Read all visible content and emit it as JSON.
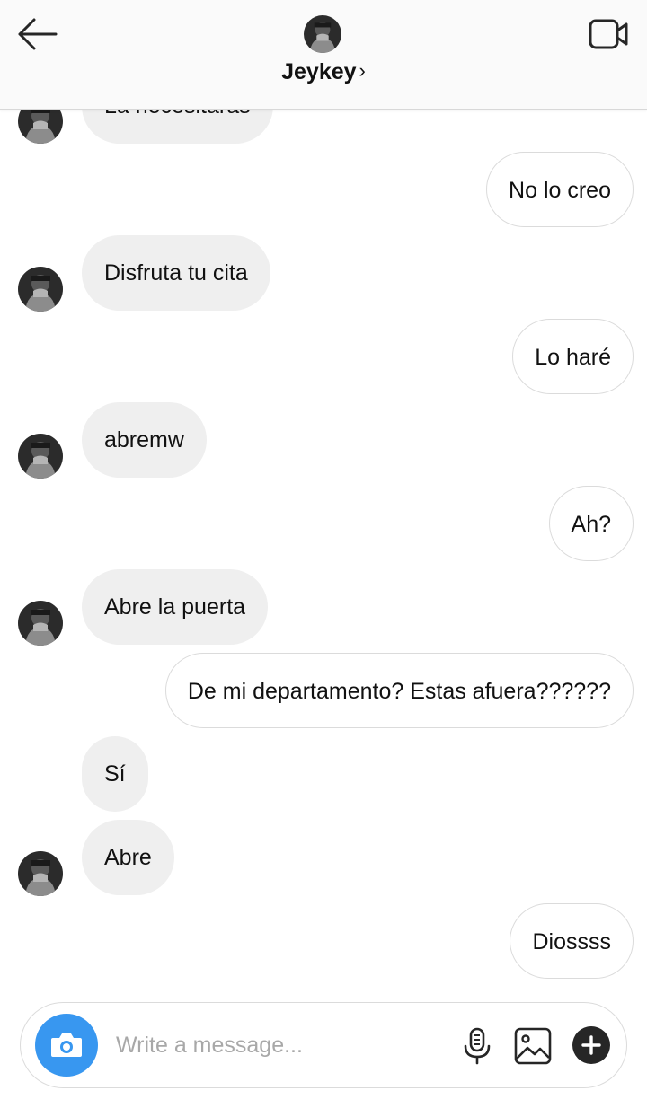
{
  "header": {
    "contact_name": "Jeykey",
    "chevron": "›",
    "back_icon": "arrow-left-icon",
    "video_icon": "video-camera-icon"
  },
  "messages": [
    {
      "from": "them",
      "text": "La necesitarás",
      "avatar": true
    },
    {
      "from": "me",
      "text": "No lo creo"
    },
    {
      "from": "them",
      "text": "Disfruta tu cita",
      "avatar": true
    },
    {
      "from": "me",
      "text": "Lo haré"
    },
    {
      "from": "them",
      "text": "abremw",
      "avatar": true
    },
    {
      "from": "me",
      "text": "Ah?"
    },
    {
      "from": "them",
      "text": "Abre la puerta",
      "avatar": true
    },
    {
      "from": "me",
      "text": "De mi departamento? Estas afuera??????"
    },
    {
      "from": "them",
      "text": "Sí",
      "avatar": false
    },
    {
      "from": "them",
      "text": "Abre",
      "avatar": true
    },
    {
      "from": "me",
      "text": "Diossss"
    }
  ],
  "composer": {
    "placeholder": "Write a message...",
    "value": "",
    "icons": [
      "camera-icon",
      "microphone-icon",
      "gallery-icon",
      "plus-icon"
    ]
  },
  "colors": {
    "accent": "#3897f0",
    "incoming_bubble": "#efefef",
    "outgoing_border": "#dbdbdb",
    "header_bg": "#fafafa"
  }
}
